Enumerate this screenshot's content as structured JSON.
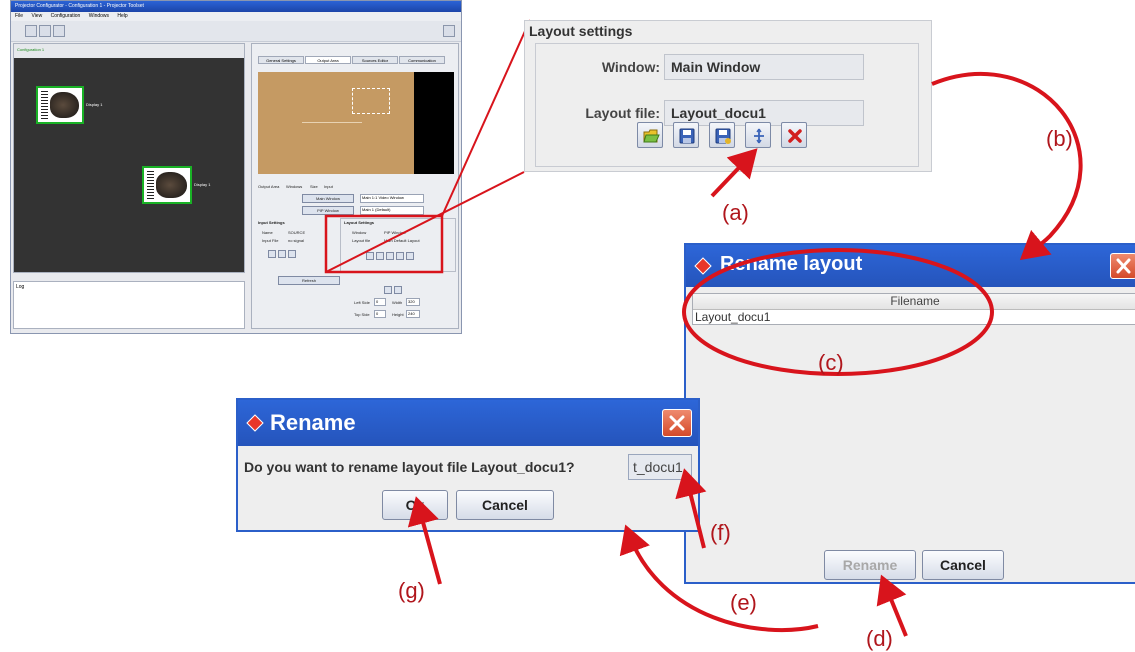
{
  "thumbnail": {
    "window_title": "Projector Configurator - Configuration 1 - Projector Toolset",
    "menu": [
      "File",
      "View",
      "Configuration",
      "Windows",
      "Help"
    ],
    "left_panel_label": "Configuration 1",
    "node_tag": "Display 1",
    "bottom_panel_label": "Log",
    "tabs": [
      "General Settings",
      "Output Area",
      "Sources Editor",
      "Communication"
    ],
    "sub_tabs": [
      "Output Area",
      "Windows",
      "Size",
      "Input"
    ],
    "window_buttons": [
      "Main Window",
      "PIP Window"
    ],
    "window_dropdowns": [
      "Main 1:1 Video Window",
      "Main 1 (Default)"
    ],
    "input_settings": {
      "heading": "Input Settings",
      "name_label": "Name",
      "name_value": "SOURCE",
      "input_file_label": "Input File",
      "input_file_value": "no signal"
    },
    "layout_settings": {
      "heading": "Layout Settings",
      "window_label": "Window",
      "window_value": "PIP Window",
      "file_label": "Layout file",
      "file_value": "Main Default Layout"
    },
    "apply_button": "Refresh",
    "position_labels": [
      "Left Side",
      "Width",
      "Top Side",
      "Height"
    ],
    "position_values": [
      "0",
      "320",
      "0",
      "240"
    ]
  },
  "layout_settings": {
    "title": "Layout settings",
    "window_label": "Window:",
    "window_value": "Main Window",
    "layout_file_label": "Layout file:",
    "layout_file_value": "Layout_docu1",
    "buttons": [
      {
        "icon": "open-folder-icon"
      },
      {
        "icon": "save-icon"
      },
      {
        "icon": "save-as-icon"
      },
      {
        "icon": "rename-icon"
      },
      {
        "icon": "delete-icon"
      }
    ]
  },
  "rename_layout_dialog": {
    "title": "Rename layout",
    "column_header": "Filename",
    "rows": [
      "Layout_docu1"
    ],
    "rename_button": "Rename",
    "cancel_button": "Cancel"
  },
  "rename_dialog": {
    "title": "Rename",
    "question": "Do you want to rename layout file Layout_docu1?",
    "input_value": "t_docu1",
    "ok_button": "Ok",
    "cancel_button": "Cancel"
  },
  "annotations": [
    "(a)",
    "(b)",
    "(c)",
    "(d)",
    "(e)",
    "(f)",
    "(g)"
  ],
  "colors": {
    "annotation_red": "#d8141c",
    "titlebar_blue": "#2b5fc9",
    "node_border_green": "#19b225",
    "preview_tan": "#c59a63"
  }
}
